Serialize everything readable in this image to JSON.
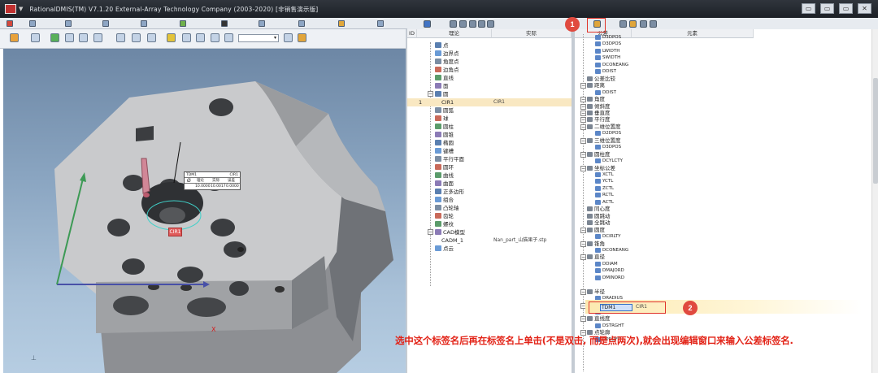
{
  "app": {
    "title": "RationalDMIS(TM) V7.1.20    External-Array Technology Company (2003-2020) [非销售演示版]"
  },
  "viewport": {
    "fcf_name": "TDM1",
    "fcf_ref": "CIR1",
    "fcf_headers": [
      "理论",
      "实际",
      "误差"
    ],
    "fcf_values": [
      "10.0000",
      "10.0017",
      "0.0000"
    ],
    "feature_tag": "CIR1",
    "axis_x": "X"
  },
  "feature_tree": {
    "columns": {
      "id": "ID",
      "nominal": "理论",
      "actual": "实际"
    },
    "rows": [
      {
        "label": "点",
        "type": "leaf",
        "icon": "point-icon"
      },
      {
        "label": "边界点",
        "type": "leaf",
        "icon": "edge-point-icon"
      },
      {
        "label": "角度点",
        "type": "leaf",
        "icon": "angle-point-icon"
      },
      {
        "label": "边角点",
        "type": "leaf",
        "icon": "corner-point-icon"
      },
      {
        "label": "直线",
        "type": "leaf",
        "icon": "line-icon"
      },
      {
        "label": "面",
        "type": "leaf",
        "icon": "plane-icon"
      },
      {
        "label": "圆",
        "type": "group",
        "icon": "circle-icon",
        "expanded": true
      },
      {
        "label": "CIR1",
        "actual": "CIR1",
        "id": "1",
        "type": "child",
        "selected": true
      },
      {
        "label": "圆弧",
        "type": "leaf",
        "icon": "arc-icon"
      },
      {
        "label": "球",
        "type": "leaf",
        "icon": "sphere-icon"
      },
      {
        "label": "圆柱",
        "type": "leaf",
        "icon": "cylinder-icon"
      },
      {
        "label": "圆锥",
        "type": "leaf",
        "icon": "cone-icon"
      },
      {
        "label": "椭圆",
        "type": "leaf",
        "icon": "ellipse-icon"
      },
      {
        "label": "键槽",
        "type": "leaf",
        "icon": "slot-icon"
      },
      {
        "label": "平行平面",
        "type": "leaf",
        "icon": "parallel-planes-icon"
      },
      {
        "label": "圆环",
        "type": "leaf",
        "icon": "torus-icon"
      },
      {
        "label": "曲线",
        "type": "leaf",
        "icon": "curve-icon"
      },
      {
        "label": "曲面",
        "type": "leaf",
        "icon": "surface-icon"
      },
      {
        "label": "正多边形",
        "type": "leaf",
        "icon": "polygon-icon"
      },
      {
        "label": "组合",
        "type": "leaf",
        "icon": "group-icon"
      },
      {
        "label": "凸轮轴",
        "type": "leaf",
        "icon": "camshaft-icon"
      },
      {
        "label": "齿轮",
        "type": "leaf",
        "icon": "gear-icon"
      },
      {
        "label": "螺纹",
        "type": "leaf",
        "icon": "thread-icon"
      },
      {
        "label": "CAD模型",
        "type": "group",
        "icon": "cad-model-icon",
        "expanded": true
      },
      {
        "label": "CADM_1",
        "actual": "Nan_part_山猫果子.stp",
        "type": "child"
      },
      {
        "label": "点云",
        "type": "leaf",
        "icon": "point-cloud-icon"
      }
    ]
  },
  "tolerance_tree": {
    "columns": {
      "tolerance": "公差",
      "element": "元素"
    },
    "rows": [
      {
        "label": "D3DPOS",
        "indent": 2
      },
      {
        "label": "D3DPOS",
        "indent": 2
      },
      {
        "label": "LWIDTH",
        "indent": 2
      },
      {
        "label": "SWIDTH",
        "indent": 2
      },
      {
        "label": "DCONEANG",
        "indent": 2
      },
      {
        "label": "DDIST",
        "indent": 2
      },
      {
        "label": "公差比较",
        "indent": 0
      },
      {
        "label": "距离",
        "indent": 0,
        "group": true
      },
      {
        "label": "DDIST",
        "indent": 2
      },
      {
        "label": "角度",
        "indent": 0,
        "group": true
      },
      {
        "label": "倾斜度",
        "indent": 0,
        "group": true
      },
      {
        "label": "垂直度",
        "indent": 0,
        "group": true
      },
      {
        "label": "平行度",
        "indent": 0,
        "group": true
      },
      {
        "label": "二维位置度",
        "indent": 0,
        "group": true
      },
      {
        "label": "D2DPOS",
        "indent": 2
      },
      {
        "label": "三维位置度",
        "indent": 0,
        "group": true
      },
      {
        "label": "D3DPOS",
        "indent": 2
      },
      {
        "label": "圆柱度",
        "indent": 0,
        "group": true
      },
      {
        "label": "DCYLCTY",
        "indent": 2
      },
      {
        "label": "坐标公差",
        "indent": 0,
        "group": true
      },
      {
        "label": "XCTL",
        "indent": 2
      },
      {
        "label": "YCTL",
        "indent": 2
      },
      {
        "label": "ZCTL",
        "indent": 2
      },
      {
        "label": "RCTL",
        "indent": 2
      },
      {
        "label": "ACTL",
        "indent": 2
      },
      {
        "label": "同心度",
        "indent": 0
      },
      {
        "label": "圆跳动",
        "indent": 0
      },
      {
        "label": "全跳动",
        "indent": 0
      },
      {
        "label": "圆度",
        "indent": 0,
        "group": true
      },
      {
        "label": "DCIRLTY",
        "indent": 2
      },
      {
        "label": "锥角",
        "indent": 0,
        "group": true
      },
      {
        "label": "DCONEANG",
        "indent": 2
      },
      {
        "label": "直径",
        "indent": 0,
        "group": true
      },
      {
        "label": "DDIAM",
        "indent": 2
      },
      {
        "label": "DMAJORD",
        "indent": 2
      },
      {
        "label": "DMINORD",
        "indent": 2
      },
      {
        "label": "TDM1",
        "indent": 1,
        "selected": true,
        "element": "CIR1"
      },
      {
        "label": "半径",
        "indent": 0,
        "group": true
      },
      {
        "label": "DRADIUS",
        "indent": 2
      },
      {
        "label": "平面度",
        "indent": 0,
        "group": true
      },
      {
        "label": "DFLAT",
        "indent": 2
      },
      {
        "label": "直线度",
        "indent": 0,
        "group": true
      },
      {
        "label": "DSTRGHT",
        "indent": 2
      },
      {
        "label": "点轮廓",
        "indent": 0,
        "group": true
      },
      {
        "label": "DPROFP",
        "indent": 2
      }
    ]
  },
  "annotations": {
    "badge1": "1",
    "badge2": "2",
    "instruction": "选中这个标签名后再在标签名上单击(不是双击, 而是点两次),就会出现编辑窗口来输入公差标签名."
  },
  "colors": {
    "accent_red": "#e04a3f",
    "selection": "#f9e8c2",
    "viewport_bg": "#8aa5c1"
  }
}
